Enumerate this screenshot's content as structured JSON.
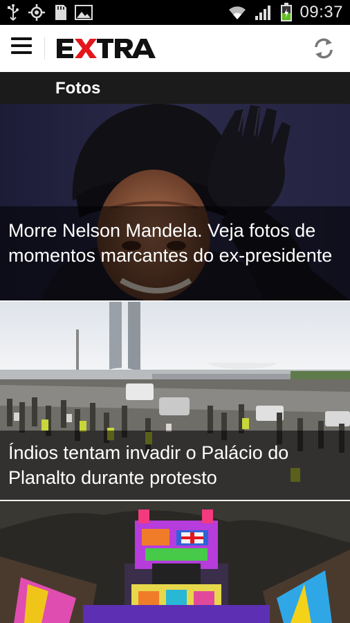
{
  "status_bar": {
    "time": "09:37",
    "icons": [
      "usb-icon",
      "gps-icon",
      "sd-card-icon",
      "gallery-icon",
      "wifi-icon",
      "signal-icon",
      "battery-icon"
    ]
  },
  "header": {
    "logo_text": "EXTRA",
    "brand_color": "#e3161c"
  },
  "section": {
    "title": "Fotos"
  },
  "gallery": [
    {
      "caption": "Morre Nelson Mandela.  Veja fotos de momentos marcantes do ex-presidente"
    },
    {
      "caption": "Índios tentam invadir o Palácio do Planalto durante protesto"
    },
    {
      "caption": ""
    }
  ]
}
